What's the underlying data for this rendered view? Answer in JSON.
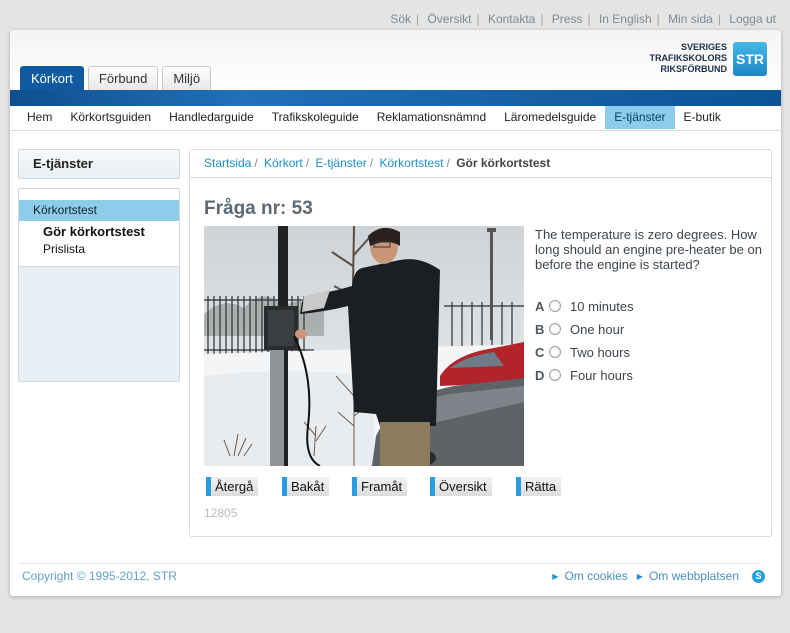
{
  "top_links": [
    "Sök",
    "Översikt",
    "Kontakta",
    "Press",
    "In English",
    "Min sida",
    "Logga ut"
  ],
  "logo": {
    "line1": "SVERIGES",
    "line2": "TRAFIKSKOLORS",
    "line3": "RIKSFÖRBUND",
    "mark": "STR"
  },
  "tabs": [
    {
      "label": "Körkort",
      "active": true
    },
    {
      "label": "Förbund",
      "active": false
    },
    {
      "label": "Miljö",
      "active": false
    }
  ],
  "main_nav": [
    {
      "label": "Hem",
      "active": false
    },
    {
      "label": "Körkortsguiden",
      "active": false
    },
    {
      "label": "Handledarguide",
      "active": false
    },
    {
      "label": "Trafikskoleguide",
      "active": false
    },
    {
      "label": "Reklamationsnämnd",
      "active": false
    },
    {
      "label": "Läromedelsguide",
      "active": false
    },
    {
      "label": "E-tjänster",
      "active": true
    },
    {
      "label": "E-butik",
      "active": false
    }
  ],
  "sidebar": {
    "title": "E-tjänster",
    "section": "Körkortstest",
    "items": [
      {
        "label": "Gör körkortstest",
        "bold": true
      },
      {
        "label": "Prislista",
        "bold": false
      }
    ]
  },
  "breadcrumb": {
    "links": [
      "Startsida",
      "Körkort",
      "E-tjänster",
      "Körkortstest"
    ],
    "current": "Gör körkortstest"
  },
  "question": {
    "heading": "Fråga nr: 53",
    "text": "The temperature is zero degrees. How long should an engine pre-heater be on before the engine is started?",
    "answers": [
      {
        "letter": "A",
        "text": "10 minutes"
      },
      {
        "letter": "B",
        "text": "One hour"
      },
      {
        "letter": "C",
        "text": "Two hours"
      },
      {
        "letter": "D",
        "text": "Four hours"
      }
    ]
  },
  "buttons": [
    "Återgå",
    "Bakåt",
    "Framåt",
    "Översikt",
    "Rätta"
  ],
  "code": "12805",
  "footer": {
    "copyright": "Copyright © 1995-2012, STR",
    "links": [
      "Om cookies",
      "Om webbplatsen"
    ]
  },
  "colors": {
    "brand_blue": "#0f5aa1",
    "accent_light_blue": "#8ccde9",
    "button_accent": "#2a9de0"
  }
}
